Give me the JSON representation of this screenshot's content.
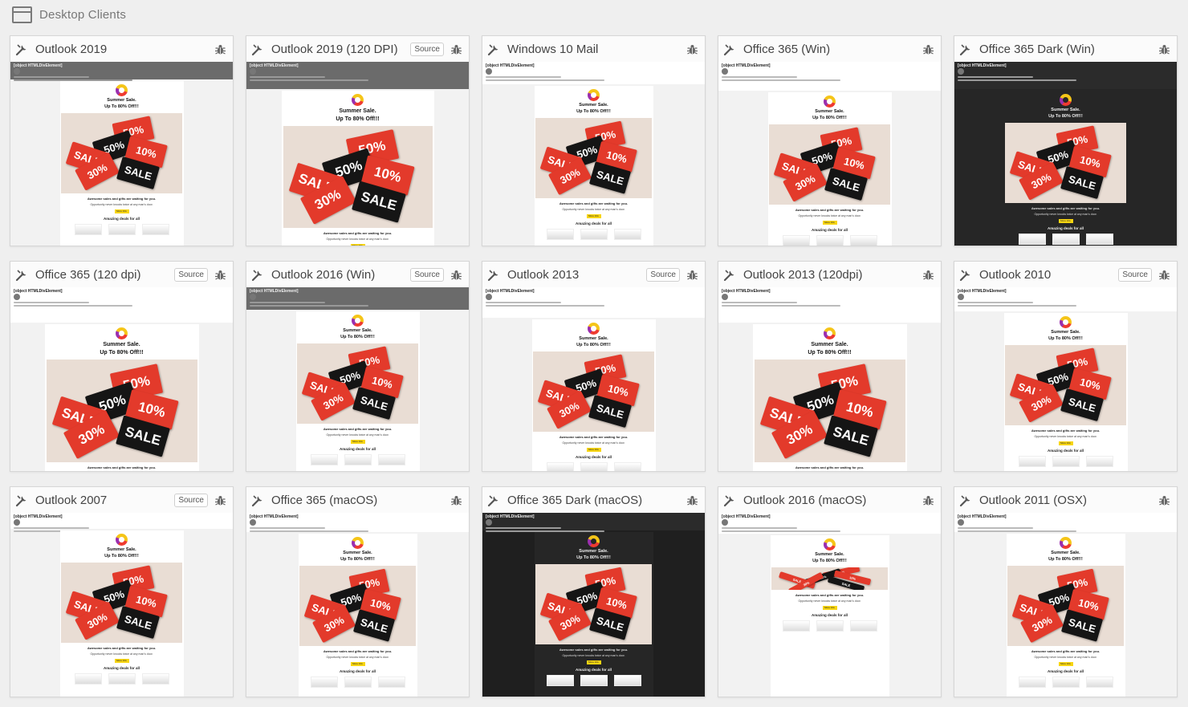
{
  "section": {
    "title": "Desktop Clients",
    "icon": "browser-window-icon"
  },
  "labels": {
    "source": "Source"
  },
  "email": {
    "object_label": "[object HTMLDivElement]",
    "headline": "Summer Sale.",
    "offer": "Up To 80% Off!!!",
    "tagline": "Awesome sales and gifts are waiting for you.",
    "subline": "Opportunity never knocks twice at any man's door.",
    "button": "More Info",
    "deals": "Amazing deals for all",
    "tags": [
      "50%",
      "50%",
      "SALE",
      "10%",
      "30%",
      "SALE"
    ]
  },
  "clients": [
    {
      "name": "Outlook 2019",
      "source": false,
      "theme": "gray"
    },
    {
      "name": "Outlook 2019 (120 DPI)",
      "source": true,
      "theme": "gray"
    },
    {
      "name": "Windows 10 Mail",
      "source": false,
      "theme": "white"
    },
    {
      "name": "Office 365 (Win)",
      "source": false,
      "theme": "white"
    },
    {
      "name": "Office 365 Dark (Win)",
      "source": false,
      "theme": "dark"
    },
    {
      "name": "Office 365 (120 dpi)",
      "source": true,
      "theme": "white"
    },
    {
      "name": "Outlook 2016 (Win)",
      "source": true,
      "theme": "gray"
    },
    {
      "name": "Outlook 2013",
      "source": true,
      "theme": "white"
    },
    {
      "name": "Outlook 2013 (120dpi)",
      "source": false,
      "theme": "white"
    },
    {
      "name": "Outlook 2010",
      "source": true,
      "theme": "white"
    },
    {
      "name": "Outlook 2007",
      "source": true,
      "theme": "white"
    },
    {
      "name": "Office 365 (macOS)",
      "source": false,
      "theme": "white"
    },
    {
      "name": "Office 365 Dark (macOS)",
      "source": false,
      "theme": "black"
    },
    {
      "name": "Outlook 2016 (macOS)",
      "source": false,
      "theme": "white"
    },
    {
      "name": "Outlook 2011 (OSX)",
      "source": false,
      "theme": "white"
    }
  ],
  "colors": {
    "sale_red": "#e33a2b",
    "sale_black": "#151515",
    "hero_bg": "#e9ddd4",
    "button_yellow": "#f7d511"
  }
}
